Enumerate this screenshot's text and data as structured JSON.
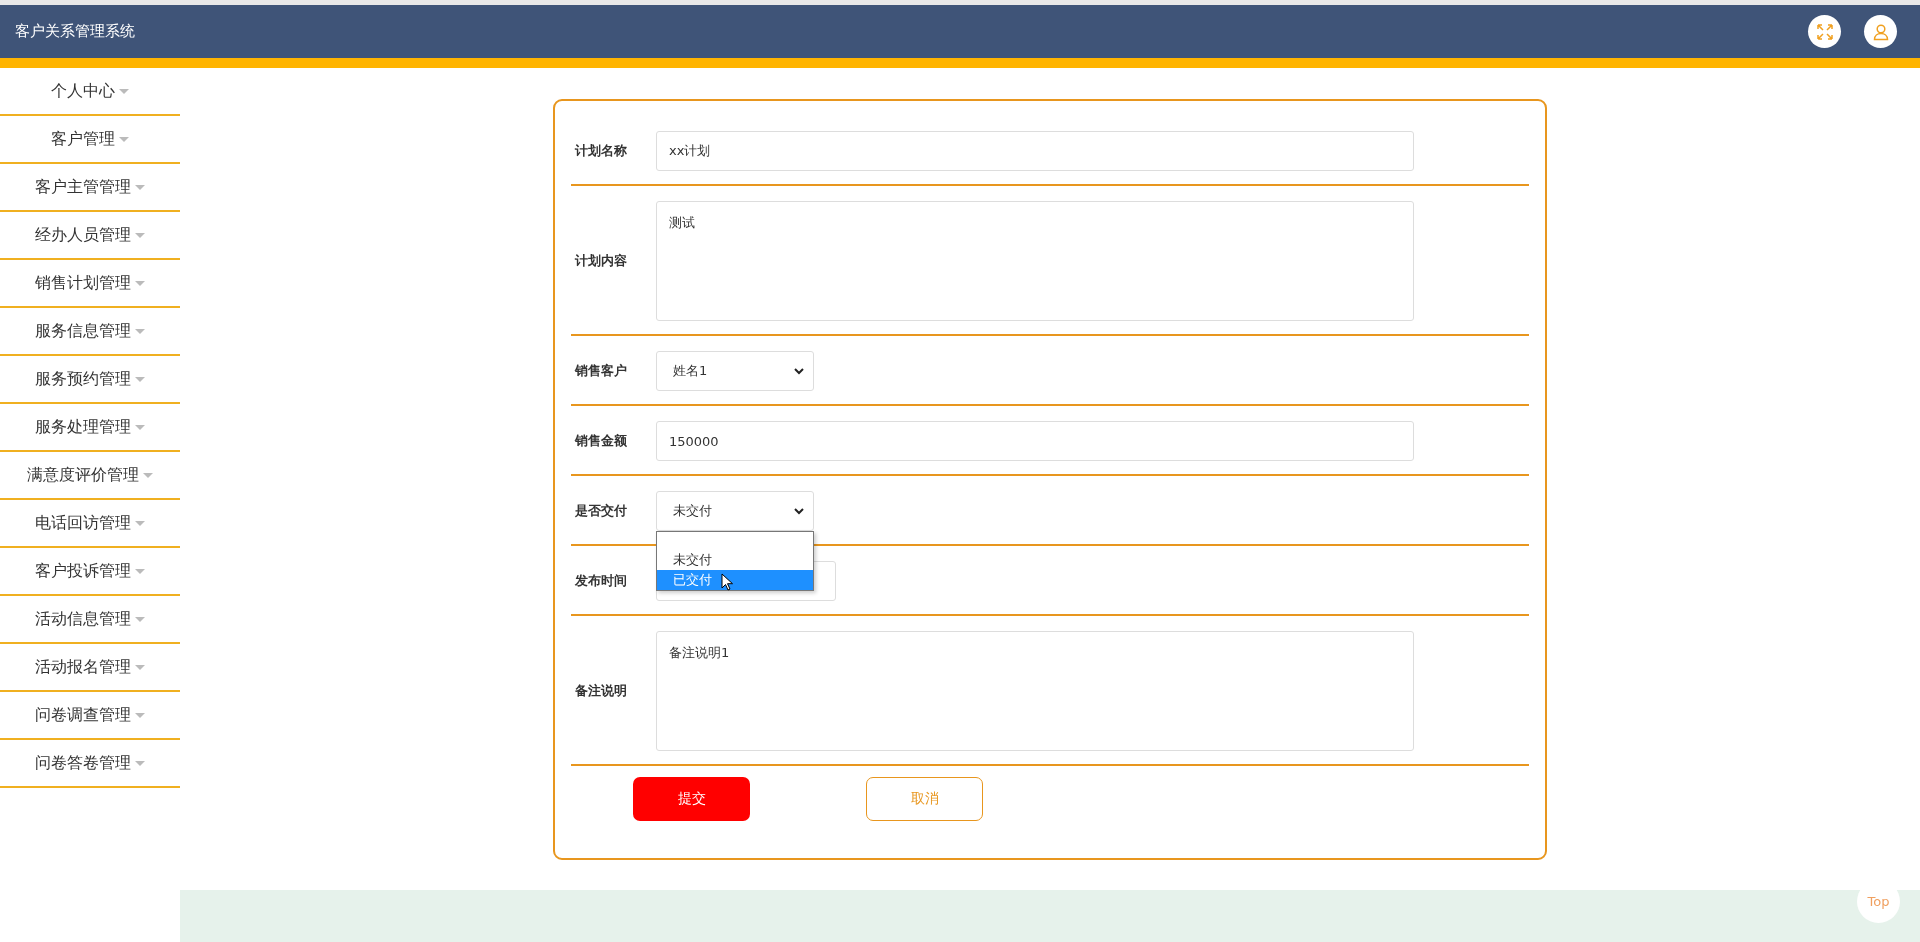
{
  "header": {
    "title": "客户关系管理系统"
  },
  "sidebar": {
    "items": [
      {
        "label": "个人中心"
      },
      {
        "label": "客户管理"
      },
      {
        "label": "客户主管管理"
      },
      {
        "label": "经办人员管理"
      },
      {
        "label": "销售计划管理"
      },
      {
        "label": "服务信息管理"
      },
      {
        "label": "服务预约管理"
      },
      {
        "label": "服务处理管理"
      },
      {
        "label": "满意度评价管理"
      },
      {
        "label": "电话回访管理"
      },
      {
        "label": "客户投诉管理"
      },
      {
        "label": "活动信息管理"
      },
      {
        "label": "活动报名管理"
      },
      {
        "label": "问卷调查管理"
      },
      {
        "label": "问卷答卷管理"
      }
    ]
  },
  "form": {
    "fields": [
      {
        "kind": "text",
        "label": "计划名称",
        "value": "xx计划"
      },
      {
        "kind": "textarea",
        "label": "计划内容",
        "value": "测试"
      },
      {
        "kind": "select",
        "label": "销售客户",
        "value": "姓名1"
      },
      {
        "kind": "text",
        "label": "销售金额",
        "value": "150000"
      },
      {
        "kind": "select",
        "label": "是否交付",
        "value": "未交付",
        "open": true,
        "options": [
          {
            "label": "未交付",
            "highlighted": false
          },
          {
            "label": "已交付",
            "highlighted": true
          }
        ]
      },
      {
        "kind": "date",
        "label": "发布时间"
      },
      {
        "kind": "textarea",
        "label": "备注说明",
        "value": "备注说明1"
      }
    ],
    "buttons": [
      {
        "kind": "primary",
        "label": "提交"
      },
      {
        "kind": "secondary",
        "label": "取消"
      }
    ]
  },
  "back_to_top": {
    "label": "Top"
  }
}
